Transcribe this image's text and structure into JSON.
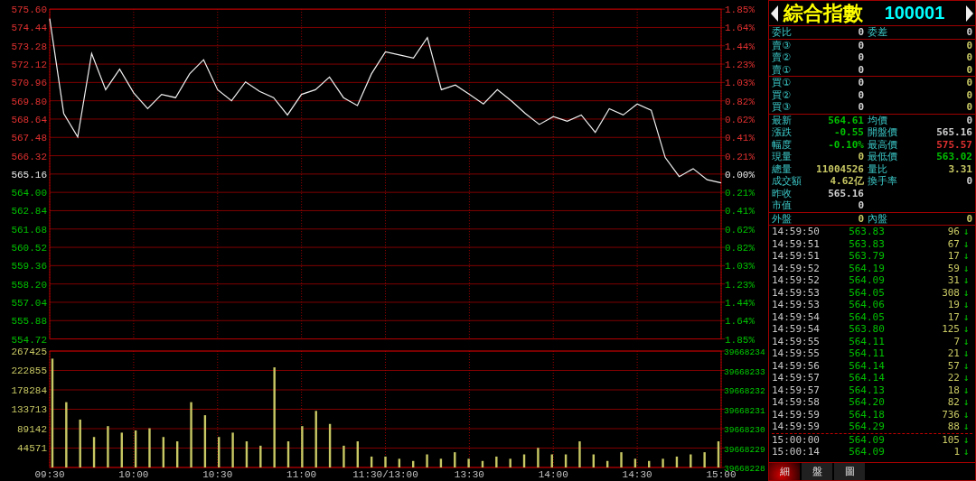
{
  "price_chart": {
    "chart_data": {
      "type": "line",
      "grid": true,
      "ylim": [
        554.72,
        575.6
      ],
      "values": [
        575.0,
        569.0,
        567.5,
        572.8,
        570.5,
        571.8,
        570.3,
        569.3,
        570.2,
        570.0,
        571.5,
        572.4,
        570.5,
        569.8,
        571.0,
        570.4,
        570.0,
        568.9,
        570.2,
        570.5,
        571.3,
        570.0,
        569.5,
        571.5,
        572.9,
        572.7,
        572.5,
        573.8,
        570.5,
        570.8,
        570.2,
        569.6,
        570.5,
        569.8,
        569.0,
        568.3,
        568.8,
        568.5,
        568.9,
        567.8,
        569.3,
        568.9,
        569.6,
        569.2,
        566.2,
        565.0,
        565.5,
        564.8,
        564.6
      ],
      "yticks": [
        {
          "value": 575.6,
          "label": "575.60"
        },
        {
          "value": 574.44,
          "label": "574.44"
        },
        {
          "value": 573.28,
          "label": "573.28"
        },
        {
          "value": 572.12,
          "label": "572.12"
        },
        {
          "value": 570.96,
          "label": "570.96"
        },
        {
          "value": 569.8,
          "label": "569.80"
        },
        {
          "value": 568.64,
          "label": "568.64"
        },
        {
          "value": 567.48,
          "label": "567.48"
        },
        {
          "value": 566.32,
          "label": "566.32"
        },
        {
          "value": 565.16,
          "label": "565.16"
        },
        {
          "value": 564.0,
          "label": "564.00"
        },
        {
          "value": 562.84,
          "label": "562.84"
        },
        {
          "value": 561.68,
          "label": "561.68"
        },
        {
          "value": 560.52,
          "label": "560.52"
        },
        {
          "value": 559.36,
          "label": "559.36"
        },
        {
          "value": 558.2,
          "label": "558.20"
        },
        {
          "value": 557.04,
          "label": "557.04"
        },
        {
          "value": 555.88,
          "label": "555.88"
        },
        {
          "value": 554.72,
          "label": "554.72"
        }
      ]
    },
    "percent_labels": [
      {
        "text": "1.85%",
        "kind": "up"
      },
      {
        "text": "1.64%",
        "kind": "up"
      },
      {
        "text": "1.44%",
        "kind": "up"
      },
      {
        "text": "1.23%",
        "kind": "up"
      },
      {
        "text": "1.03%",
        "kind": "up"
      },
      {
        "text": "0.82%",
        "kind": "up"
      },
      {
        "text": "0.62%",
        "kind": "up"
      },
      {
        "text": "0.41%",
        "kind": "up"
      },
      {
        "text": "0.21%",
        "kind": "up"
      },
      {
        "text": "0.00%",
        "kind": "flat"
      },
      {
        "text": "0.21%",
        "kind": "down"
      },
      {
        "text": "0.41%",
        "kind": "down"
      },
      {
        "text": "0.62%",
        "kind": "down"
      },
      {
        "text": "0.82%",
        "kind": "down"
      },
      {
        "text": "1.03%",
        "kind": "down"
      },
      {
        "text": "1.23%",
        "kind": "down"
      },
      {
        "text": "1.44%",
        "kind": "down"
      },
      {
        "text": "1.64%",
        "kind": "down"
      },
      {
        "text": "1.85%",
        "kind": "down"
      }
    ]
  },
  "volume_chart": {
    "chart_data": {
      "type": "bar",
      "grid": true,
      "ylim": [
        0,
        267425
      ],
      "values": [
        250000,
        150000,
        110000,
        70000,
        95000,
        80000,
        85000,
        90000,
        70000,
        60000,
        150000,
        120000,
        70000,
        80000,
        60000,
        50000,
        230000,
        60000,
        95000,
        130000,
        100000,
        50000,
        60000,
        25000,
        25000,
        20000,
        15000,
        30000,
        20000,
        35000,
        20000,
        15000,
        25000,
        20000,
        30000,
        45000,
        30000,
        30000,
        60000,
        30000,
        15000,
        35000,
        20000,
        15000,
        20000,
        25000,
        30000,
        35000,
        60000
      ],
      "yticks": [
        {
          "value": 267425,
          "label": "267425"
        },
        {
          "value": 222855,
          "label": "222855"
        },
        {
          "value": 178284,
          "label": "178284"
        },
        {
          "value": 133713,
          "label": "133713"
        },
        {
          "value": 89142,
          "label": "89142"
        },
        {
          "value": 44571,
          "label": "44571"
        }
      ]
    },
    "time_labels": [
      "09:30",
      "10:00",
      "10:30",
      "11:00",
      "11:30/13:00",
      "13:30",
      "14:00",
      "14:30",
      "15:00"
    ],
    "right_labels": [
      "39668234",
      "39668233",
      "39668232",
      "39668231",
      "39668230",
      "39668229",
      "39668228"
    ]
  },
  "header": {
    "title": "綜合指數",
    "code": "100001"
  },
  "quote_sections": [
    {
      "rows": [
        {
          "label": "委比",
          "value": {
            "text": "0",
            "color": "#d0d0d0"
          },
          "label_2": "委差",
          "value_2": {
            "text": "0",
            "color": "#d0d0d0"
          }
        }
      ]
    },
    {
      "rows": [
        {
          "label": "賣③",
          "value": {
            "text": "0",
            "color": "#d0d0d0"
          },
          "value_2": {
            "text": "0",
            "color": "#c8c864"
          }
        },
        {
          "label": "賣②",
          "value": {
            "text": "0",
            "color": "#d0d0d0"
          },
          "value_2": {
            "text": "0",
            "color": "#c8c864"
          }
        },
        {
          "label": "賣①",
          "value": {
            "text": "0",
            "color": "#d0d0d0"
          },
          "value_2": {
            "text": "0",
            "color": "#c8c864"
          }
        }
      ]
    },
    {
      "rows": [
        {
          "label": "買①",
          "value": {
            "text": "0",
            "color": "#d0d0d0"
          },
          "value_2": {
            "text": "0",
            "color": "#c8c864"
          }
        },
        {
          "label": "買②",
          "value": {
            "text": "0",
            "color": "#d0d0d0"
          },
          "value_2": {
            "text": "0",
            "color": "#c8c864"
          }
        },
        {
          "label": "買③",
          "value": {
            "text": "0",
            "color": "#d0d0d0"
          },
          "value_2": {
            "text": "0",
            "color": "#c8c864"
          }
        }
      ]
    },
    {
      "rows": [
        {
          "label": "最新",
          "value": {
            "text": "564.61",
            "color": "#00c000"
          },
          "label_2": "均價",
          "value_2": {
            "text": "0",
            "color": "#d0d0d0"
          }
        },
        {
          "label": "漲跌",
          "value": {
            "text": "-0.55",
            "color": "#00c000"
          },
          "label_2": "開盤價",
          "value_2": {
            "text": "565.16",
            "color": "#d0d0d0"
          }
        },
        {
          "label": "幅度",
          "value": {
            "text": "-0.10%",
            "color": "#00c000"
          },
          "label_2": "最高價",
          "value_2": {
            "text": "575.57",
            "color": "#e03030"
          }
        },
        {
          "label": "現量",
          "value": {
            "text": "0",
            "color": "#c8c864"
          },
          "label_2": "最低價",
          "value_2": {
            "text": "563.02",
            "color": "#00c000"
          }
        },
        {
          "label": "總量",
          "value": {
            "text": "11004526",
            "color": "#c8c864"
          },
          "label_2": "量比",
          "value_2": {
            "text": "3.31",
            "color": "#c8c864"
          }
        },
        {
          "label": "成交額",
          "value": {
            "text": "4.62亿",
            "color": "#c8c864"
          },
          "label_2": "換手率",
          "value_2": {
            "text": "0",
            "color": "#d0d0d0"
          }
        },
        {
          "label": "昨收",
          "value": {
            "text": "565.16",
            "color": "#d0d0d0"
          }
        },
        {
          "label": "市值",
          "value": {
            "text": "0",
            "color": "#d0d0d0"
          }
        }
      ]
    },
    {
      "rows": [
        {
          "label": "外盤",
          "value": {
            "text": "0",
            "color": "#c8c864"
          },
          "label_2": "內盤",
          "value_2": {
            "text": "0",
            "color": "#c8c864"
          }
        }
      ]
    }
  ],
  "trades": [
    {
      "time": "14:59:50",
      "price": "563.83",
      "volume": "96",
      "arrow": "↓"
    },
    {
      "time": "14:59:51",
      "price": "563.83",
      "volume": "67",
      "arrow": "↓"
    },
    {
      "time": "14:59:51",
      "price": "563.79",
      "volume": "17",
      "arrow": "↓"
    },
    {
      "time": "14:59:52",
      "price": "564.19",
      "volume": "59",
      "arrow": "↓"
    },
    {
      "time": "14:59:52",
      "price": "564.09",
      "volume": "31",
      "arrow": "↓"
    },
    {
      "time": "14:59:53",
      "price": "564.05",
      "volume": "308",
      "arrow": "↓"
    },
    {
      "time": "14:59:53",
      "price": "564.06",
      "volume": "19",
      "arrow": "↓"
    },
    {
      "time": "14:59:54",
      "price": "564.05",
      "volume": "17",
      "arrow": "↓"
    },
    {
      "time": "14:59:54",
      "price": "563.80",
      "volume": "125",
      "arrow": "↓"
    },
    {
      "time": "14:59:55",
      "price": "564.11",
      "volume": "7",
      "arrow": "↓"
    },
    {
      "time": "14:59:55",
      "price": "564.11",
      "volume": "21",
      "arrow": "↓"
    },
    {
      "time": "14:59:56",
      "price": "564.14",
      "volume": "57",
      "arrow": "↓"
    },
    {
      "time": "14:59:57",
      "price": "564.14",
      "volume": "22",
      "arrow": "↓"
    },
    {
      "time": "14:59:57",
      "price": "564.13",
      "volume": "18",
      "arrow": "↓"
    },
    {
      "time": "14:59:58",
      "price": "564.20",
      "volume": "82",
      "arrow": "↓"
    },
    {
      "time": "14:59:59",
      "price": "564.18",
      "volume": "736",
      "arrow": "↓"
    },
    {
      "time": "14:59:59",
      "price": "564.29",
      "volume": "88",
      "arrow": "↓"
    }
  ],
  "closing_trades": [
    {
      "time": "15:00:00",
      "price": "564.09",
      "volume": "105",
      "arrow": "↓"
    },
    {
      "time": "15:00:14",
      "price": "564.09",
      "volume": "1",
      "arrow": "↓"
    }
  ],
  "tabs": [
    {
      "label": "細",
      "selected": true
    },
    {
      "label": "盤",
      "selected": false
    },
    {
      "label": "圖",
      "selected": false
    }
  ]
}
